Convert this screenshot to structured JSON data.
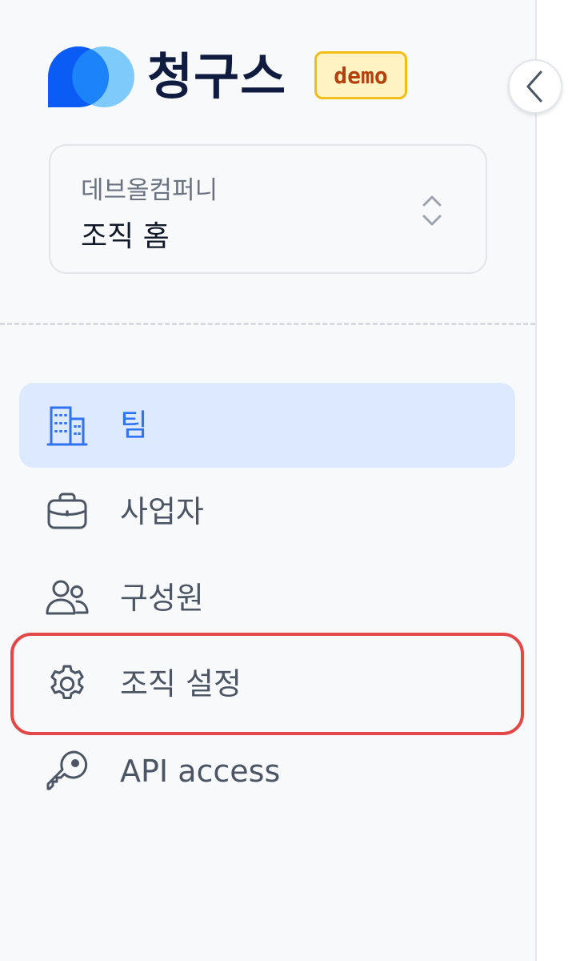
{
  "brand": {
    "name": "청구스",
    "badge": "demo",
    "colors": {
      "primary": "#0a5cf5",
      "secondary": "#7ecbfb",
      "text": "#0f1c3f"
    }
  },
  "collapse_button": {
    "icon": "chevron-left-icon"
  },
  "org_selector": {
    "org_name": "데브올컴퍼니",
    "current_page": "조직 홈",
    "icon": "chevron-up-down-icon"
  },
  "nav": {
    "items": [
      {
        "label": "팀",
        "icon": "building-icon",
        "active": true
      },
      {
        "label": "사업자",
        "icon": "briefcase-icon",
        "active": false
      },
      {
        "label": "구성원",
        "icon": "users-icon",
        "active": false
      },
      {
        "label": "조직 설정",
        "icon": "gear-icon",
        "active": false,
        "highlighted": true
      },
      {
        "label": "API access",
        "icon": "key-icon",
        "active": false
      }
    ]
  },
  "colors": {
    "active_bg": "#dde9fe",
    "active_text": "#2f73f2",
    "highlight_border": "#e24848",
    "badge_border": "#f2bd16",
    "badge_bg": "#fff3c4",
    "badge_text": "#b4400b"
  }
}
